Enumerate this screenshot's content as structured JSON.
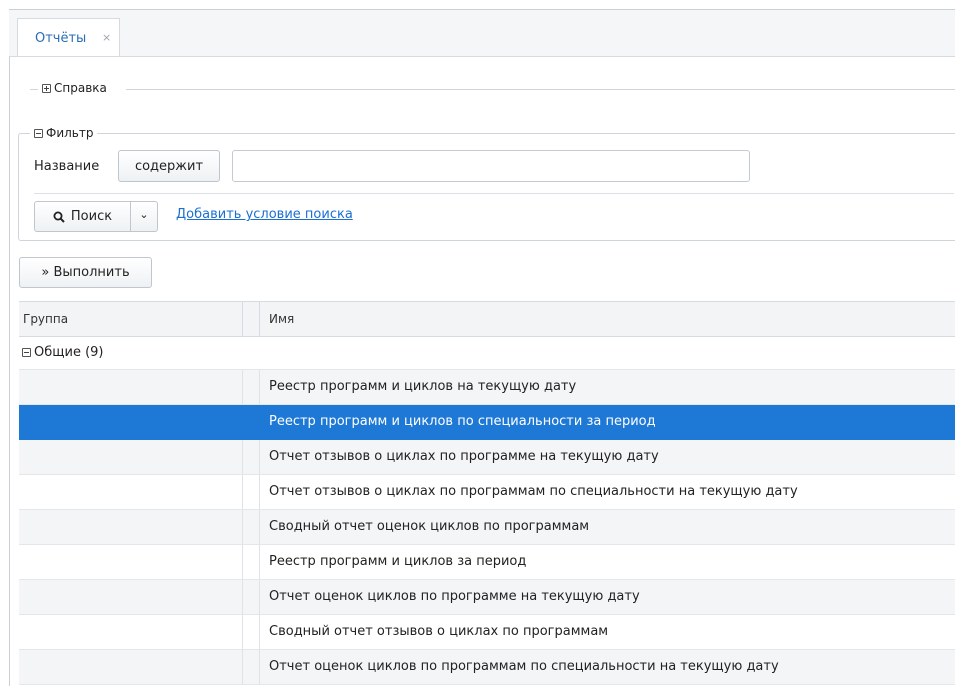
{
  "tabs": [
    {
      "label": "Отчёты",
      "close": "×"
    }
  ],
  "help_section": {
    "label": "Справка"
  },
  "filter": {
    "legend": "Фильтр",
    "field_label": "Название",
    "operator": "содержит",
    "value": "",
    "search_button": "Поиск",
    "dropdown_glyph": "⌄",
    "add_condition_link": "Добавить условие поиска"
  },
  "execute_button": "» Выполнить",
  "table": {
    "columns": [
      "Группа",
      "Имя"
    ],
    "group": "Общие (9)",
    "rows": [
      "Реестр программ и циклов на текущую дату",
      "Реестр программ и циклов по специальности за период",
      "Отчет отзывов о циклах по программе на текущую дату",
      "Отчет отзывов о циклах по программам по специальности на текущую дату",
      "Сводный отчет оценок циклов по программам",
      "Реестр программ и циклов за период",
      "Отчет оценок циклов по программе на текущую дату",
      "Сводный отчет отзывов о циклах по программам",
      "Отчет оценок циклов по программам по специальности на текущую дату"
    ],
    "selected_row": 2
  },
  "icons": {
    "search": "magnifier-icon",
    "collapse": "minus-box-icon",
    "expand": "plus-box-icon"
  },
  "colors": {
    "selection": "#1e78d6",
    "link": "#1a6fd0",
    "tab_text": "#2a6db5"
  }
}
